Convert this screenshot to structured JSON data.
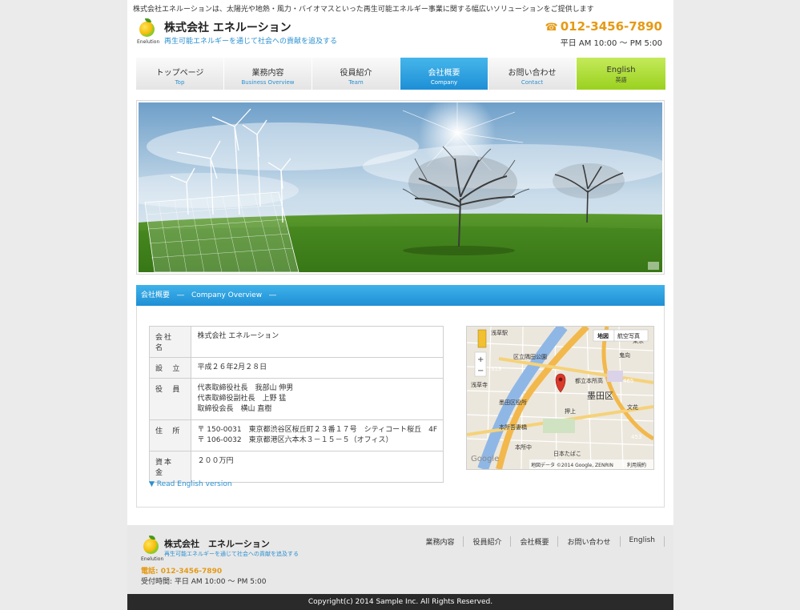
{
  "header": {
    "tagline": "株式会社エネルーションは、太陽光や地熱・風力・バイオマスといった再生可能エネルギー事業に関する幅広いソリューションをご提供します",
    "logo_text": "Enelution",
    "company_name": "株式会社 エネルーション",
    "slogan": "再生可能エネルギーを通じて社会への貢献を追及する",
    "phone": "012-3456-7890",
    "hours": "平日 AM 10:00 〜 PM 5:00"
  },
  "nav": [
    {
      "jp": "トップページ",
      "en": "Top"
    },
    {
      "jp": "業務内容",
      "en": "Business Overview"
    },
    {
      "jp": "役員紹介",
      "en": "Team"
    },
    {
      "jp": "会社概要",
      "en": "Company"
    },
    {
      "jp": "お問い合わせ",
      "en": "Contact"
    },
    {
      "jp": "English",
      "en": "英語"
    }
  ],
  "section": {
    "title": "会社概要　―　Company Overview　―"
  },
  "company_info": {
    "name_label": "会社名",
    "name_value": "株式会社 エネルーション",
    "founded_label": "設立",
    "founded_value": "平成２６年2月２８日",
    "officers_label": "役員",
    "officers": [
      "代表取締役社長　我部山 伸男",
      "代表取締役副社長　上野 猛",
      "取締役会長　横山 直樹"
    ],
    "address_label": "住所",
    "addresses": [
      "〒 150-0031　東京都渋谷区桜丘町２３番１７号　シティコート桜丘　4F",
      "〒 106-0032　東京都港区六本木３－１５－５（オフィス）"
    ],
    "capital_label": "資本金",
    "capital_value": "２００万円"
  },
  "map": {
    "tab_map": "地図",
    "tab_aerial": "航空写真",
    "zoom_in": "+",
    "zoom_out": "−",
    "labels": [
      "浅草駅",
      "区立隅田公園",
      "東京",
      "319",
      "鬼向",
      "浅草寺",
      "都立本所高",
      "465",
      "墨田区",
      "墨田区役所",
      "押上",
      "文花",
      "本所吾妻橋",
      "本所中",
      "453",
      "日本たばこ"
    ],
    "attribution": "地図データ ©2014 Google, ZENRIN",
    "terms": "利用規約",
    "google": "Google"
  },
  "read_english": "▼ Read English version",
  "footer": {
    "company_name": "株式会社　エネルーション",
    "slogan": "再生可能エネルギーを通じて社会への貢献を追及する",
    "logo_text": "Enelution",
    "phone_label": "電話: 012-3456-7890",
    "hours": "受付時間: 平日 AM 10:00 〜 PM 5:00",
    "nav": [
      "業務内容",
      "役員紹介",
      "会社概要",
      "お問い合わせ",
      "English"
    ],
    "copyright": "Copyright(c) 2014 Sample Inc. All Rights Reserved."
  },
  "colors": {
    "accent_blue": "#2a8fd0",
    "accent_orange": "#e59a15",
    "accent_green": "#9ad11f"
  }
}
